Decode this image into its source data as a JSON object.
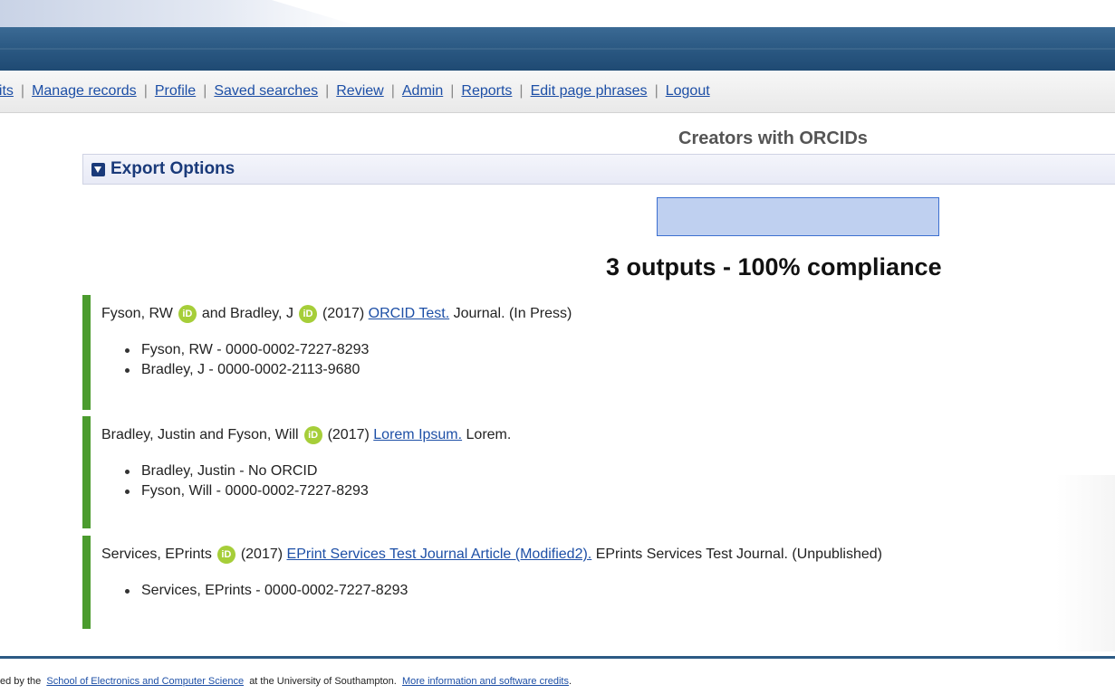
{
  "menu": {
    "items": [
      {
        "label": "osits"
      },
      {
        "label": "Manage records"
      },
      {
        "label": "Profile"
      },
      {
        "label": "Saved searches"
      },
      {
        "label": "Review"
      },
      {
        "label": "Admin"
      },
      {
        "label": "Reports"
      },
      {
        "label": "Edit page phrases"
      },
      {
        "label": "Logout"
      }
    ],
    "separator": "|"
  },
  "page_title": "Creators with ORCIDs",
  "export": {
    "label": "Export Options",
    "icon": "triangle-down-icon"
  },
  "compliance": {
    "text": "3 outputs - 100% compliance",
    "progress_fraction": 1.0
  },
  "orcid_badge": {
    "label": "iD",
    "color": "#a6ce39"
  },
  "accent_bar_color": "#4b9b2e",
  "records": [
    {
      "authors_a": "Fyson, RW",
      "joiner": "and",
      "authors_b": "Bradley, J",
      "year": "(2017)",
      "title": "ORCID Test.",
      "tail": "Journal. (In Press)",
      "creators": [
        {
          "text": "Fyson, RW - 0000-0002-7227-8293"
        },
        {
          "text": "Bradley, J - 0000-0002-2113-9680"
        }
      ]
    },
    {
      "authors_a": "Bradley, Justin and Fyson, Will",
      "year": "(2017)",
      "title": "Lorem Ipsum.",
      "tail": "Lorem.",
      "creators": [
        {
          "text": "Bradley, Justin - No ORCID"
        },
        {
          "text": "Fyson, Will - 0000-0002-7227-8293"
        }
      ]
    },
    {
      "authors_a": "Services, EPrints",
      "year": "(2017)",
      "title": "EPrint Services Test Journal Article (Modified2).",
      "tail": "EPrints Services Test Journal. (Unpublished)",
      "creators": [
        {
          "text": "Services, EPrints - 0000-0002-7227-8293"
        }
      ]
    }
  ],
  "footer": {
    "prefix": "ed by the",
    "link1": "School of Electronics and Computer Science",
    "middle": "at the University of Southampton.",
    "link2": "More information and software credits",
    "suffix": "."
  }
}
